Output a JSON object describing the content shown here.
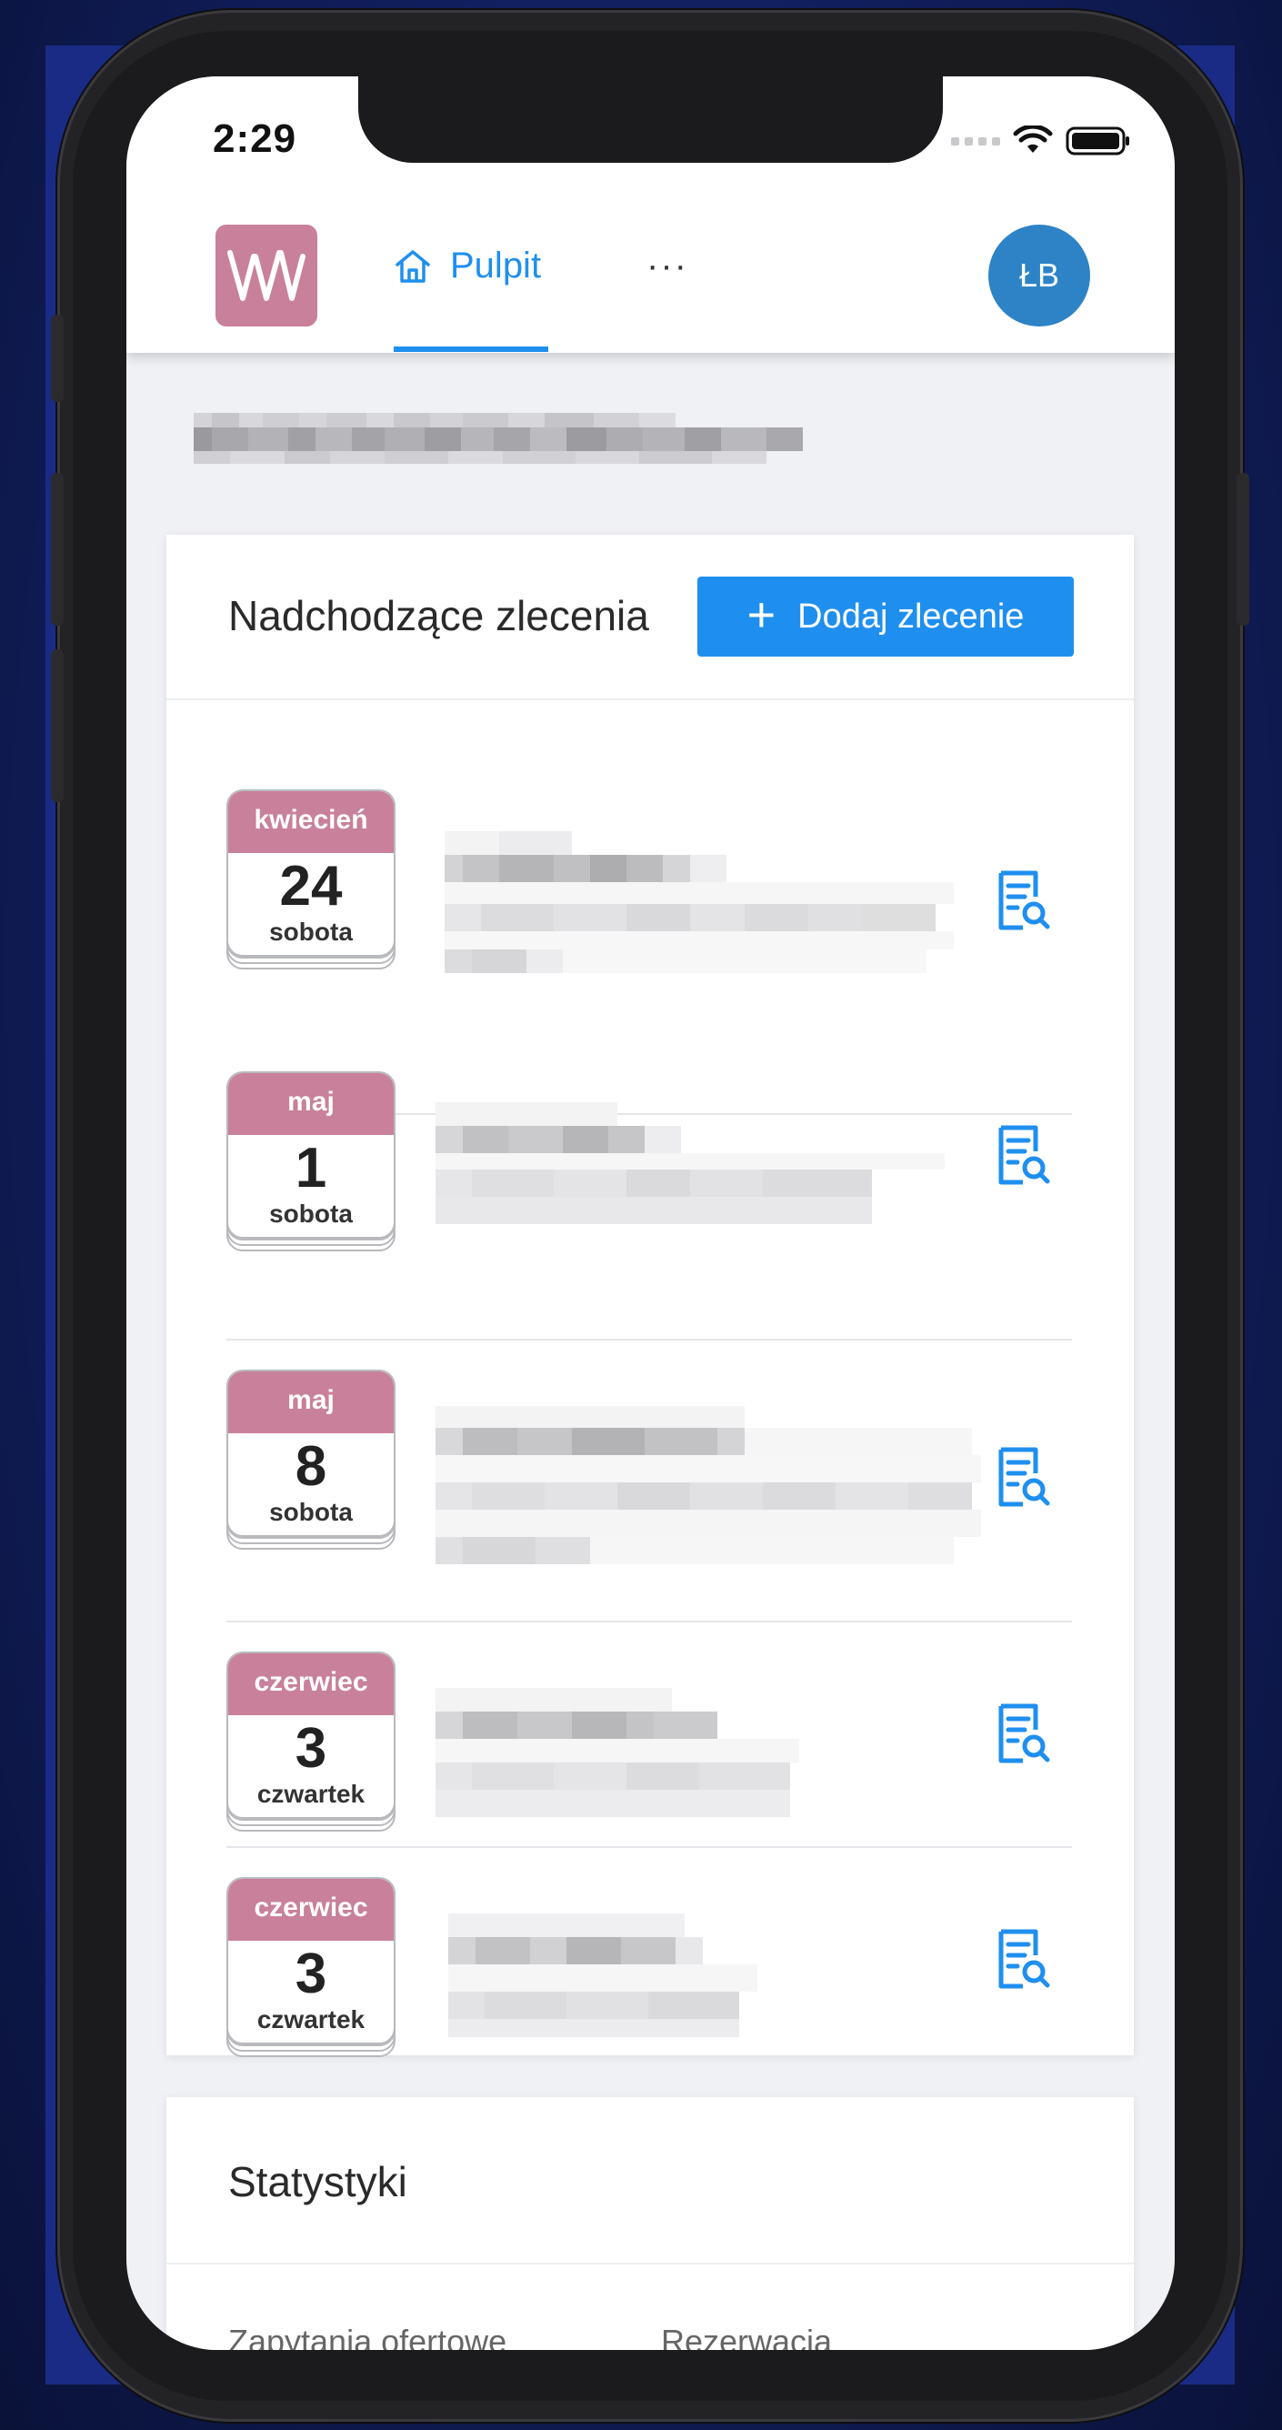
{
  "status_bar": {
    "time": "2:29"
  },
  "header": {
    "logo_alt": "W",
    "nav_tab_label": "Pulpit",
    "more_label": "···",
    "avatar_initials": "ŁB"
  },
  "upcoming": {
    "title": "Nadchodzące zlecenia",
    "add_button_label": "Dodaj zlecenie",
    "orders": [
      {
        "month": "kwiecień",
        "day": "24",
        "weekday": "sobota"
      },
      {
        "month": "maj",
        "day": "1",
        "weekday": "sobota"
      },
      {
        "month": "maj",
        "day": "8",
        "weekday": "sobota"
      },
      {
        "month": "czerwiec",
        "day": "3",
        "weekday": "czwartek"
      },
      {
        "month": "czerwiec",
        "day": "3",
        "weekday": "czwartek"
      }
    ]
  },
  "stats": {
    "title": "Statystyki",
    "col1_label": "Zapytania ofertowe",
    "col2_label": "Rezerwacja"
  },
  "colors": {
    "accent": "#1f8fef",
    "brand": "#c9809a",
    "avatar": "#2d83c6"
  },
  "icons": {
    "home": "home-icon",
    "plus": "plus-icon",
    "details": "document-search-icon",
    "wifi": "wifi-icon",
    "battery": "battery-icon"
  }
}
